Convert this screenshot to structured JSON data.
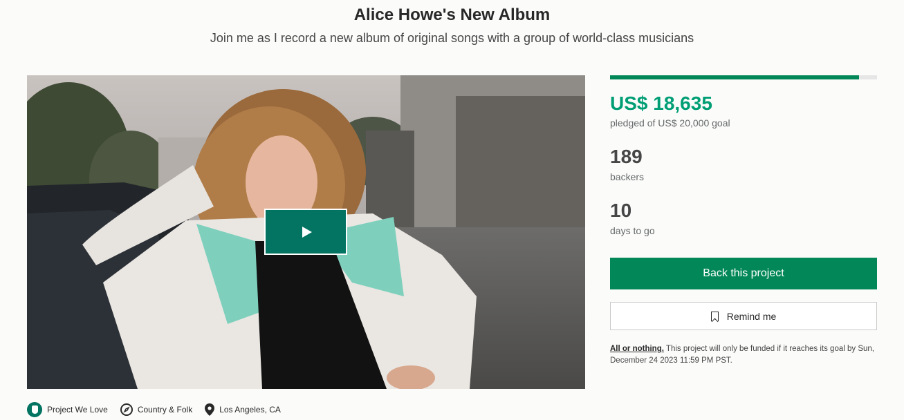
{
  "project": {
    "title": "Alice Howe's New Album",
    "subtitle": "Join me as I record a new album of original songs with a group of world-class musicians"
  },
  "stats": {
    "progress_percent": 93.2,
    "pledged_amount": "US$ 18,635",
    "pledged_label": "pledged of US$ 20,000 goal",
    "backers_count": "189",
    "backers_label": "backers",
    "days_count": "10",
    "days_label": "days to go"
  },
  "actions": {
    "back_label": "Back this project",
    "remind_label": "Remind me"
  },
  "funding": {
    "link_text": "All or nothing.",
    "note_text": " This project will only be funded if it reaches its goal by Sun, December 24 2023 11:59 PM PST."
  },
  "tags": {
    "project_we_love": "Project We Love",
    "category": "Country & Folk",
    "location": "Los Angeles, CA"
  },
  "icons": {
    "play": "play-icon",
    "bookmark": "bookmark-icon",
    "badge": "project-we-love-icon",
    "compass": "compass-icon",
    "location": "map-pin-icon"
  },
  "colors": {
    "accent_green": "#009e74",
    "button_green": "#028858",
    "play_button": "#037362"
  }
}
